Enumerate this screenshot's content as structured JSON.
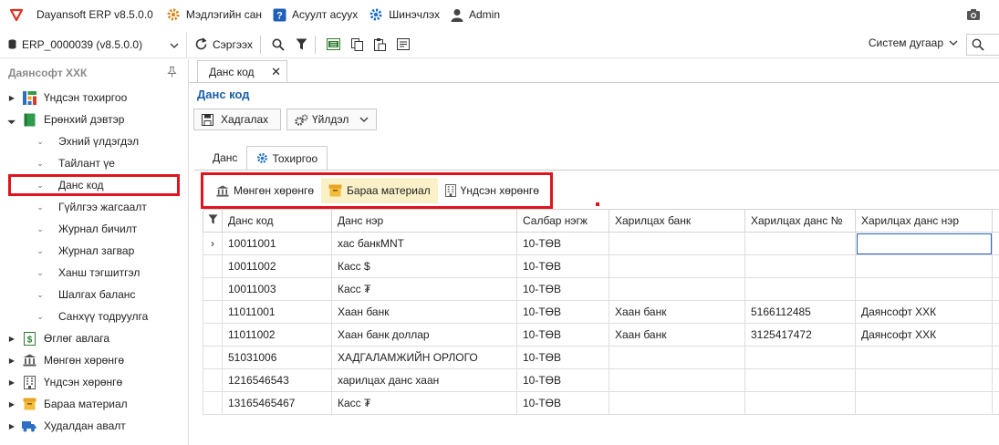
{
  "titlebar": {
    "app_title": "Dayansoft ERP v8.5.0.0",
    "menus": [
      {
        "label": "Мэдлэгийн сан",
        "icon": "gear-icon"
      },
      {
        "label": "Асуулт асуух",
        "icon": "question-icon"
      },
      {
        "label": "Шинэчлэх",
        "icon": "gear-icon"
      },
      {
        "label": "Admin",
        "icon": "user-icon"
      }
    ]
  },
  "toolbar": {
    "database": "ERP_0000039 (v8.5.0.0)",
    "refresh_label": "Сэргээх",
    "system_select": "Систем дугаар"
  },
  "sidebar": {
    "company": "Даянсофт ХХК",
    "items": [
      {
        "label": "Үндсэн тохиргоо",
        "level": 0,
        "icon": "settings-grid-icon"
      },
      {
        "label": "Ерөнхий дэвтэр",
        "level": 0,
        "icon": "ledger-icon"
      },
      {
        "label": "Эхний үлдэгдэл",
        "level": 1
      },
      {
        "label": "Тайлант үе",
        "level": 1
      },
      {
        "label": "Данс код",
        "level": 1,
        "active": true
      },
      {
        "label": "Гүйлгээ жагсаалт",
        "level": 1
      },
      {
        "label": "Журнал бичилт",
        "level": 1
      },
      {
        "label": "Журнал загвар",
        "level": 1
      },
      {
        "label": "Ханш тэгшитгэл",
        "level": 1
      },
      {
        "label": "Шалгах баланс",
        "level": 1
      },
      {
        "label": "Санхүү тодруулга",
        "level": 1
      },
      {
        "label": "Өглөг авлага",
        "level": 0,
        "icon": "dollar-icon"
      },
      {
        "label": "Мөнгөн хөрөнгө",
        "level": 0,
        "icon": "bank-icon"
      },
      {
        "label": "Үндсэн хөрөнгө",
        "level": 0,
        "icon": "building-icon"
      },
      {
        "label": "Бараа материал",
        "level": 0,
        "icon": "box-icon"
      },
      {
        "label": "Худалдан авалт",
        "level": 0,
        "icon": "truck-icon"
      }
    ]
  },
  "main": {
    "doc_tab": "Данс код",
    "page_title": "Данс код",
    "save_label": "Хадгалах",
    "action_label": "Үйлдэл",
    "subtabs": [
      "Данс",
      "Тохиргоо"
    ],
    "categories": [
      "Мөнгөн хөрөнгө",
      "Бараа материал",
      "Үндсэн хөрөнгө"
    ],
    "columns": [
      "Данс код",
      "Данс нэр",
      "Салбар нэгж",
      "Харилцах банк",
      "Харилцах данс №",
      "Харилцах данс нэр"
    ],
    "rows": [
      [
        "10011001",
        "хас банкMNT",
        "10-ТӨВ",
        "",
        "",
        ""
      ],
      [
        "10011002",
        "Касс $",
        "10-ТӨВ",
        "",
        "",
        ""
      ],
      [
        "10011003",
        "Касс ₮",
        "10-ТӨВ",
        "",
        "",
        ""
      ],
      [
        "11011001",
        "Хаан банк",
        "10-ТӨВ",
        "Хаан банк",
        "5166112485",
        "Даянсофт ХХК"
      ],
      [
        "11011002",
        "Хаан банк доллар",
        "10-ТӨВ",
        "Хаан банк",
        "3125417472",
        "Даянсофт ХХК"
      ],
      [
        "51031006",
        "ХАДГАЛАМЖИЙН ОРЛОГО",
        "10-ТӨВ",
        "",
        "",
        ""
      ],
      [
        "1216546543",
        "харилцах данс хаан",
        "10-ТӨВ",
        "",
        "",
        ""
      ],
      [
        "13165465467",
        "Касс ₮",
        "10-ТӨВ",
        "",
        "",
        ""
      ]
    ]
  }
}
